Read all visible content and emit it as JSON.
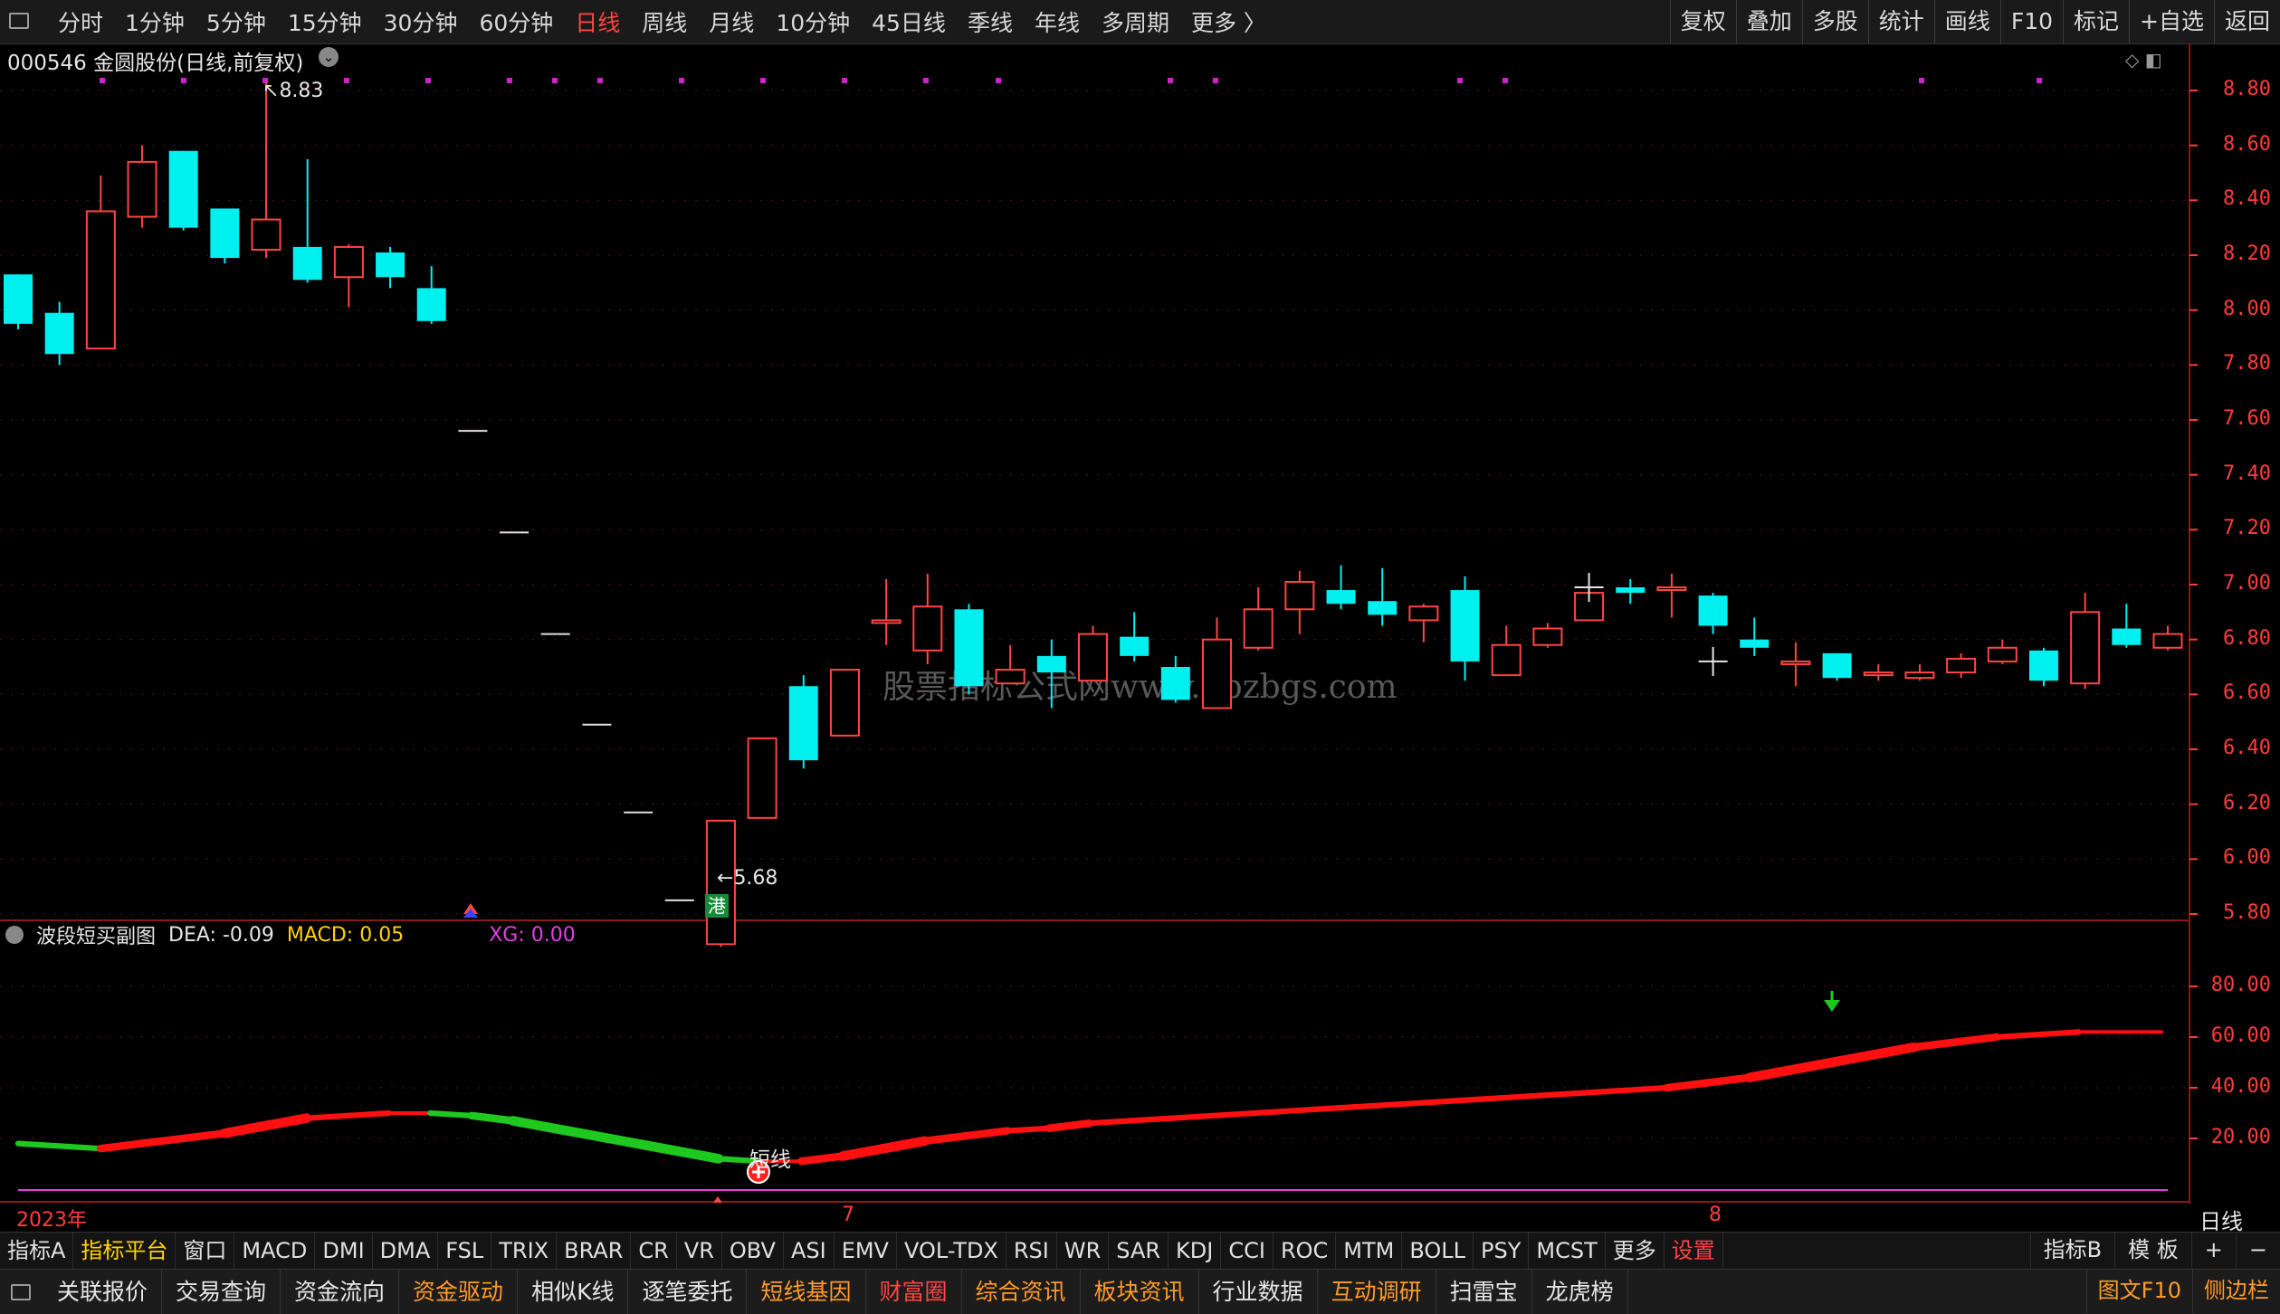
{
  "toolbar": {
    "periods": [
      "分时",
      "1分钟",
      "5分钟",
      "15分钟",
      "30分钟",
      "60分钟",
      "日线",
      "周线",
      "月线",
      "10分钟",
      "45日线",
      "季线",
      "年线",
      "多周期",
      "更多 〉"
    ],
    "active_period": "日线",
    "right_buttons": [
      "复权",
      "叠加",
      "多股",
      "统计",
      "画线",
      "F10",
      "标记",
      "+自选",
      "返回"
    ]
  },
  "chart": {
    "title": "000546 金圆股份(日线,前复权)",
    "high_label": "8.83",
    "low_label": "5.68",
    "hk_badge": "港",
    "watermark": "股票指标公式网www.gpzbgs.com",
    "price_axis": [
      "8.80",
      "8.60",
      "8.40",
      "8.20",
      "8.00",
      "7.80",
      "7.60",
      "7.40",
      "7.20",
      "7.00",
      "6.80",
      "6.60",
      "6.40",
      "6.20",
      "6.00",
      "5.80"
    ],
    "candles": [
      {
        "o": 8.13,
        "h": 8.13,
        "l": 7.93,
        "c": 7.95
      },
      {
        "o": 7.99,
        "h": 8.03,
        "l": 7.8,
        "c": 7.84
      },
      {
        "o": 7.86,
        "h": 8.49,
        "l": 7.86,
        "c": 8.36
      },
      {
        "o": 8.34,
        "h": 8.6,
        "l": 8.3,
        "c": 8.54
      },
      {
        "o": 8.58,
        "h": 8.58,
        "l": 8.29,
        "c": 8.3
      },
      {
        "o": 8.37,
        "h": 8.37,
        "l": 8.17,
        "c": 8.19
      },
      {
        "o": 8.22,
        "h": 8.83,
        "l": 8.19,
        "c": 8.33
      },
      {
        "o": 8.23,
        "h": 8.55,
        "l": 8.1,
        "c": 8.11
      },
      {
        "o": 8.12,
        "h": 8.24,
        "l": 8.01,
        "c": 8.23
      },
      {
        "o": 8.21,
        "h": 8.23,
        "l": 8.08,
        "c": 8.12
      },
      {
        "o": 8.08,
        "h": 8.16,
        "l": 7.95,
        "c": 7.96
      },
      {
        "o": 7.56,
        "h": 7.56,
        "l": 7.56,
        "c": 7.56
      },
      {
        "o": 7.19,
        "h": 7.19,
        "l": 7.19,
        "c": 7.19
      },
      {
        "o": 6.82,
        "h": 6.82,
        "l": 6.82,
        "c": 6.82
      },
      {
        "o": 6.49,
        "h": 6.49,
        "l": 6.49,
        "c": 6.49
      },
      {
        "o": 6.17,
        "h": 6.17,
        "l": 6.17,
        "c": 6.17
      },
      {
        "o": 5.85,
        "h": 5.85,
        "l": 5.85,
        "c": 5.85
      },
      {
        "o": 5.69,
        "h": 6.14,
        "l": 5.68,
        "c": 6.14
      },
      {
        "o": 6.15,
        "h": 6.44,
        "l": 6.15,
        "c": 6.44
      },
      {
        "o": 6.63,
        "h": 6.67,
        "l": 6.33,
        "c": 6.36
      },
      {
        "o": 6.45,
        "h": 6.69,
        "l": 6.45,
        "c": 6.69
      },
      {
        "o": 6.87,
        "h": 7.02,
        "l": 6.78,
        "c": 6.87
      },
      {
        "o": 6.76,
        "h": 7.04,
        "l": 6.71,
        "c": 6.92
      },
      {
        "o": 6.91,
        "h": 6.93,
        "l": 6.6,
        "c": 6.63
      },
      {
        "o": 6.64,
        "h": 6.78,
        "l": 6.64,
        "c": 6.69
      },
      {
        "o": 6.74,
        "h": 6.8,
        "l": 6.55,
        "c": 6.68
      },
      {
        "o": 6.65,
        "h": 6.85,
        "l": 6.65,
        "c": 6.82
      },
      {
        "o": 6.81,
        "h": 6.9,
        "l": 6.72,
        "c": 6.74
      },
      {
        "o": 6.7,
        "h": 6.74,
        "l": 6.57,
        "c": 6.58
      },
      {
        "o": 6.55,
        "h": 6.88,
        "l": 6.55,
        "c": 6.8
      },
      {
        "o": 6.77,
        "h": 6.99,
        "l": 6.76,
        "c": 6.91
      },
      {
        "o": 6.91,
        "h": 7.05,
        "l": 6.82,
        "c": 7.01
      },
      {
        "o": 6.98,
        "h": 7.07,
        "l": 6.91,
        "c": 6.93
      },
      {
        "o": 6.94,
        "h": 7.06,
        "l": 6.85,
        "c": 6.89
      },
      {
        "o": 6.87,
        "h": 6.93,
        "l": 6.79,
        "c": 6.92
      },
      {
        "o": 6.98,
        "h": 7.03,
        "l": 6.65,
        "c": 6.72
      },
      {
        "o": 6.67,
        "h": 6.85,
        "l": 6.67,
        "c": 6.78
      },
      {
        "o": 6.78,
        "h": 6.86,
        "l": 6.77,
        "c": 6.84
      },
      {
        "o": 6.87,
        "h": 6.99,
        "l": 6.87,
        "c": 6.97
      },
      {
        "o": 6.99,
        "h": 7.02,
        "l": 6.93,
        "c": 6.97
      },
      {
        "o": 6.99,
        "h": 7.04,
        "l": 6.88,
        "c": 6.99
      },
      {
        "o": 6.96,
        "h": 6.97,
        "l": 6.82,
        "c": 6.85
      },
      {
        "o": 6.8,
        "h": 6.88,
        "l": 6.74,
        "c": 6.77
      },
      {
        "o": 6.72,
        "h": 6.79,
        "l": 6.63,
        "c": 6.72
      },
      {
        "o": 6.75,
        "h": 6.75,
        "l": 6.65,
        "c": 6.66
      },
      {
        "o": 6.67,
        "h": 6.71,
        "l": 6.65,
        "c": 6.68
      },
      {
        "o": 6.66,
        "h": 6.71,
        "l": 6.65,
        "c": 6.68
      },
      {
        "o": 6.68,
        "h": 6.75,
        "l": 6.66,
        "c": 6.73
      },
      {
        "o": 6.72,
        "h": 6.8,
        "l": 6.71,
        "c": 6.77
      },
      {
        "o": 6.76,
        "h": 6.77,
        "l": 6.63,
        "c": 6.65
      },
      {
        "o": 6.64,
        "h": 6.97,
        "l": 6.62,
        "c": 6.9
      },
      {
        "o": 6.84,
        "h": 6.93,
        "l": 6.77,
        "c": 6.78
      },
      {
        "o": 6.77,
        "h": 6.85,
        "l": 6.76,
        "c": 6.82
      }
    ],
    "doji_markers": [
      {
        "x_index": 38,
        "price": 6.99
      },
      {
        "x_index": 41,
        "price": 6.72
      }
    ],
    "magenta_dots_count": 24
  },
  "sub_chart": {
    "title": "波段短买副图",
    "dea": "DEA: -0.09",
    "macd": "MACD: 0.05",
    "xg": "XG: 0.00",
    "axis": [
      "80.00",
      "60.00",
      "40.00",
      "20.00"
    ],
    "signal_label": "短线",
    "curve": [
      18,
      17,
      16,
      18,
      20,
      22,
      25,
      28,
      29,
      30,
      30,
      29,
      27,
      24,
      21,
      18,
      15,
      12,
      11,
      11,
      13,
      16,
      19,
      21,
      23,
      24,
      26,
      27,
      28,
      29,
      30,
      31,
      32,
      33,
      34,
      35,
      36,
      37,
      38,
      39,
      40,
      42,
      44,
      47,
      50,
      53,
      56,
      58,
      60,
      61,
      62,
      62,
      62
    ]
  },
  "dates": {
    "year": "2023年",
    "m7": "7",
    "m8": "8"
  },
  "period_label": "日线",
  "indicators": [
    "指标A",
    "指标平台",
    "窗口",
    "MACD",
    "DMI",
    "DMA",
    "FSL",
    "TRIX",
    "BRAR",
    "CR",
    "VR",
    "OBV",
    "ASI",
    "EMV",
    "VOL-TDX",
    "RSI",
    "WR",
    "SAR",
    "KDJ",
    "CCI",
    "ROC",
    "MTM",
    "BOLL",
    "PSY",
    "MCST",
    "更多",
    "设置"
  ],
  "indicators_right": [
    "指标B",
    "模 板",
    "+",
    "−"
  ],
  "functions": [
    {
      "label": "关联报价",
      "color": "#e6e6e6"
    },
    {
      "label": "交易查询",
      "color": "#e6e6e6"
    },
    {
      "label": "资金流向",
      "color": "#e6e6e6"
    },
    {
      "label": "资金驱动",
      "color": "#ff9a2a"
    },
    {
      "label": "相似K线",
      "color": "#e6e6e6"
    },
    {
      "label": "逐笔委托",
      "color": "#e6e6e6"
    },
    {
      "label": "短线基因",
      "color": "#ff9a2a"
    },
    {
      "label": "财富圈",
      "color": "#ff4444"
    },
    {
      "label": "综合资讯",
      "color": "#ff9a2a"
    },
    {
      "label": "板块资讯",
      "color": "#ff9a2a"
    },
    {
      "label": "行业数据",
      "color": "#e6e6e6"
    },
    {
      "label": "互动调研",
      "color": "#ff9a2a"
    },
    {
      "label": "扫雷宝",
      "color": "#e6e6e6"
    },
    {
      "label": "龙虎榜",
      "color": "#e6e6e6"
    }
  ],
  "functions_right": [
    "图文F10",
    "侧边栏"
  ],
  "colors": {
    "up": "#ff4444",
    "down": "#00f0f0",
    "bg": "#000000",
    "axis": "#ff3c3c",
    "curve_up": "#ff1010",
    "curve_down": "#1ec81e"
  }
}
